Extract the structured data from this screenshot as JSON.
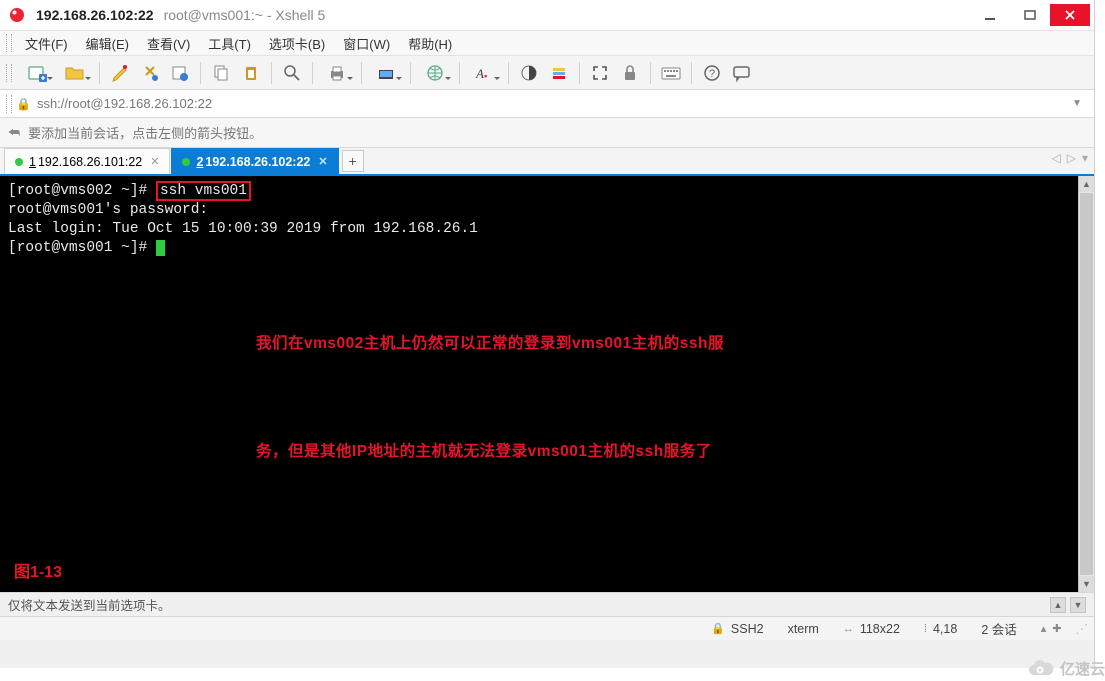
{
  "title": {
    "host": "192.168.26.102:22",
    "session": "root@vms001:~ - Xshell 5"
  },
  "menu": {
    "file": "文件(F)",
    "edit": "编辑(E)",
    "view": "查看(V)",
    "tools": "工具(T)",
    "tabs": "选项卡(B)",
    "window": "窗口(W)",
    "help": "帮助(H)"
  },
  "address": {
    "url": "ssh://root@192.168.26.102:22"
  },
  "hint": {
    "text": "要添加当前会话，点击左侧的箭头按钮。"
  },
  "tabs": {
    "tab1": {
      "index": "1",
      "label": " 192.168.26.101:22"
    },
    "tab2": {
      "index": "2",
      "label": " 192.168.26.102:22"
    }
  },
  "terminal": {
    "line1_prompt": "[root@vms002 ~]# ",
    "line1_cmd": "ssh vms001",
    "line2": "root@vms001's password:",
    "line3": "Last login: Tue Oct 15 10:00:39 2019 from 192.168.26.1",
    "line4_prompt": "[root@vms001 ~]# "
  },
  "annotation": {
    "l1": "我们在vms002主机上仍然可以正常的登录到vms001主机的ssh服",
    "l2": "务，但是其他IP地址的主机就无法登录vms001主机的ssh服务了"
  },
  "figure_label": "图1-13",
  "status_local": {
    "text": "仅将文本发送到当前选项卡。"
  },
  "status_remote": {
    "protocol": "SSH2",
    "termtype": "xterm",
    "size": "118x22",
    "cursor": "4,18",
    "sessions": "2 会话"
  },
  "watermark": "亿速云"
}
